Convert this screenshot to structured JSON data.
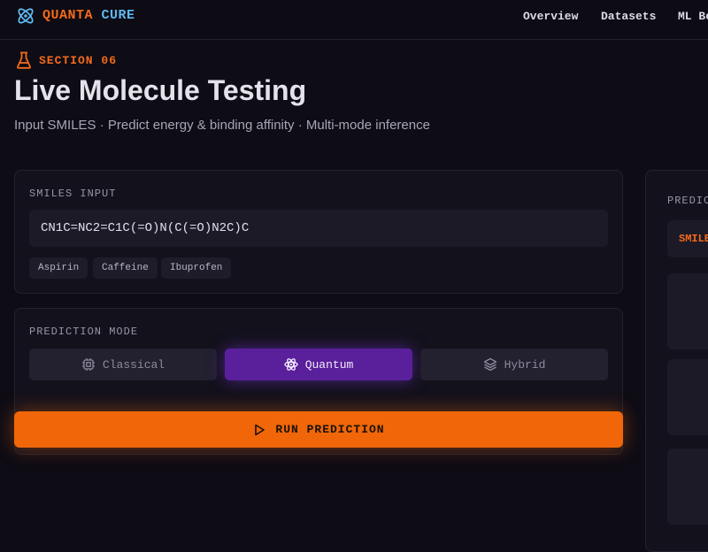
{
  "header": {
    "brand_part1": "QUANTA",
    "brand_part2": "CURE",
    "nav": [
      "Overview",
      "Datasets",
      "ML Be"
    ]
  },
  "hero": {
    "section_label": "SECTION 06",
    "title": "Live Molecule Testing",
    "subtitle": "Input SMILES · Predict energy & binding affinity · Multi-mode inference"
  },
  "smiles": {
    "label": "SMILES INPUT",
    "value": "CN1C=NC2=C1C(=O)N(C(=O)N2C)C",
    "presets": [
      "Aspirin",
      "Caffeine",
      "Ibuprofen"
    ]
  },
  "mode": {
    "label": "PREDICTION MODE",
    "options": [
      {
        "label": "Classical",
        "icon": "cpu-icon",
        "active": false
      },
      {
        "label": "Quantum",
        "icon": "atom-icon",
        "active": true
      },
      {
        "label": "Hybrid",
        "icon": "layers-icon",
        "active": false
      }
    ]
  },
  "run_button": "RUN PREDICTION",
  "results": {
    "label": "PREDIC",
    "tab_label": "SMILE"
  },
  "colors": {
    "accent": "#f06608",
    "brand_blue": "#5fb8f0",
    "active_mode": "#5a1f9a",
    "background": "#0e0c15"
  }
}
